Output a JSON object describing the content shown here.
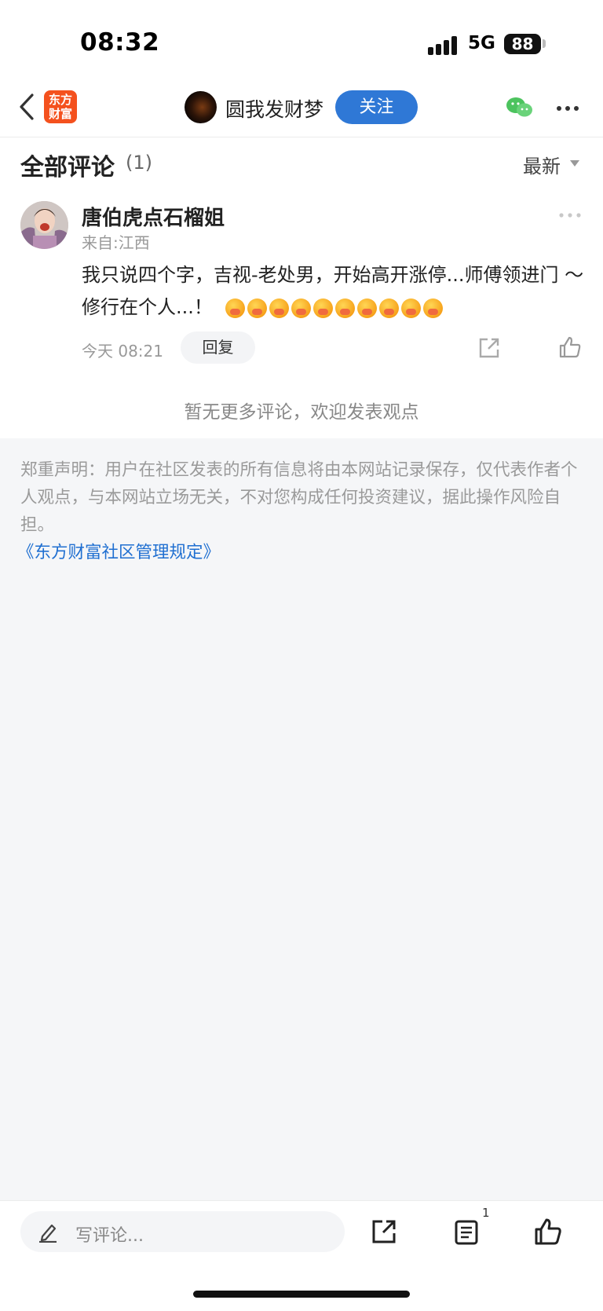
{
  "status_bar": {
    "time": "08:32",
    "network": "5G",
    "battery": "88"
  },
  "nav": {
    "logo_line1": "东方",
    "logo_line2": "财富",
    "username": "圆我发财梦",
    "follow_label": "关注"
  },
  "comments": {
    "title": "全部评论",
    "count": "(1)",
    "sort_label": "最新",
    "items": [
      {
        "username": "唐伯虎点石榴姐",
        "location": "来自:江西",
        "text": "我只说四个字，吉视-老处男，开始高开涨停...师傅领进门 ～修行在个人...！",
        "emoji_count": 10,
        "time": "今天 08:21",
        "reply_label": "回复"
      }
    ],
    "no_more": "暂无更多评论，欢迎发表观点"
  },
  "disclaimer": {
    "text": "郑重声明：用户在社区发表的所有信息将由本网站记录保存，仅代表作者个人观点，与本网站立场无关，不对您构成任何投资建议，据此操作风险自担。",
    "link": "《东方财富社区管理规定》"
  },
  "bottom_bar": {
    "input_placeholder": "写评论...",
    "list_count": "1"
  },
  "colors": {
    "accent": "#2f78d6",
    "brand": "#f4511e",
    "link": "#1f6fd1"
  }
}
